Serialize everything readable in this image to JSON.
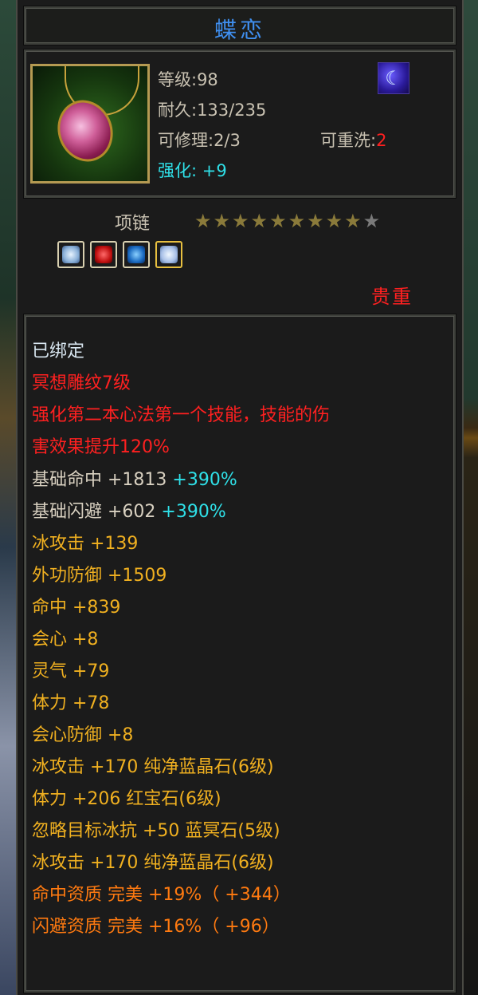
{
  "item": {
    "name": "蝶恋",
    "level": "等级:98",
    "durability": "耐久:133/235",
    "repair": "可修理:2/3",
    "reforge_label": "可重洗:",
    "reforge_value": "2",
    "enhance_label": "强化:",
    "enhance_value": "+9",
    "type": "项链",
    "stars_filled": 9,
    "stars_total": 10,
    "rarity": "贵重",
    "sockets": [
      "diamond-gem-icon",
      "ruby-gem-icon",
      "sapphire-gem-icon",
      "diamond-gem-icon"
    ]
  },
  "stats": [
    {
      "text": "已绑定",
      "parts": []
    },
    {
      "text": "冥想雕纹7级"
    },
    {
      "text": "强化第二本心法第一个技能，技能的伤"
    },
    {
      "text": "害效果提升120%"
    },
    {
      "text": "基础命中  +1813",
      "extra": "+390%"
    },
    {
      "text": "基础闪避  +602",
      "extra": "+390%"
    },
    {
      "text": "冰攻击  +139"
    },
    {
      "text": "外功防御  +1509"
    },
    {
      "text": "命中  +839"
    },
    {
      "text": "会心  +8"
    },
    {
      "text": "灵气  +79"
    },
    {
      "text": "体力  +78"
    },
    {
      "text": "会心防御  +8"
    },
    {
      "text": "冰攻击  +170  纯净蓝晶石(6级)"
    },
    {
      "text": "体力  +206  红宝石(6级)"
    },
    {
      "text": "忽略目标冰抗  +50  蓝冥石(5级)"
    },
    {
      "text": "冰攻击  +170  纯净蓝晶石(6级)"
    },
    {
      "text": "命中资质    完美  +19%（ +344）"
    },
    {
      "text": "闪避资质    完美  +16%（ +96）"
    }
  ]
}
